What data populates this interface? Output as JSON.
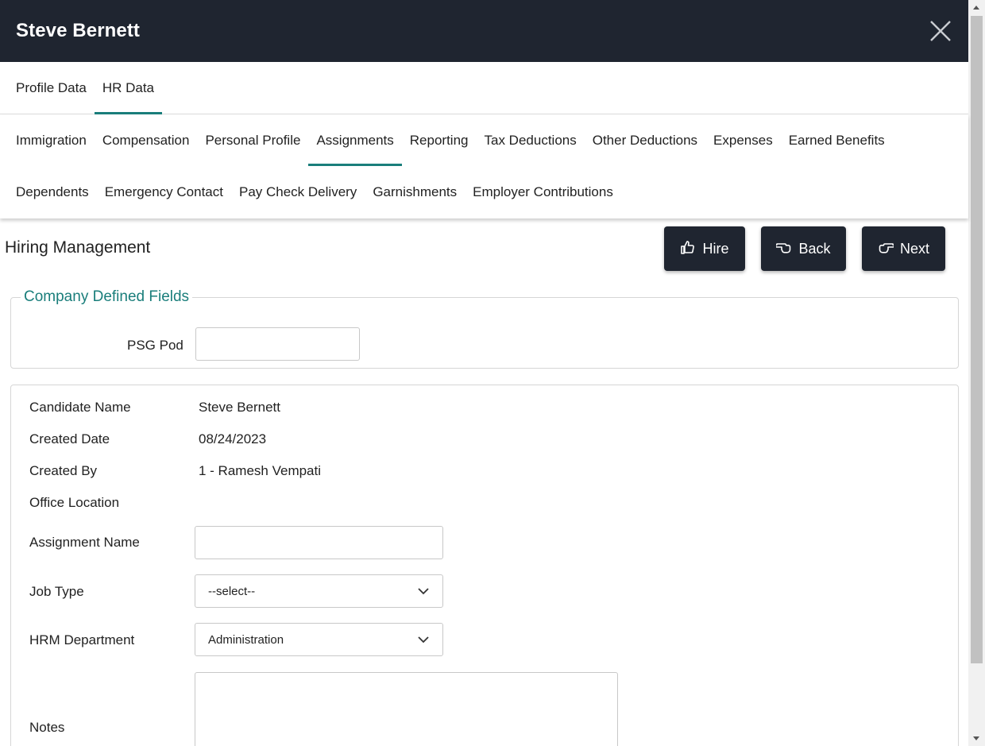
{
  "window": {
    "title": "Steve Bernett"
  },
  "primary_tabs": [
    {
      "label": "Profile Data",
      "active": false
    },
    {
      "label": "HR Data",
      "active": true
    }
  ],
  "secondary_tabs_row1": [
    {
      "label": "Immigration"
    },
    {
      "label": "Compensation"
    },
    {
      "label": "Personal Profile"
    },
    {
      "label": "Assignments",
      "active": true
    },
    {
      "label": "Reporting"
    },
    {
      "label": "Tax Deductions"
    },
    {
      "label": "Other Deductions"
    },
    {
      "label": "Expenses"
    },
    {
      "label": "Earned Benefits"
    }
  ],
  "secondary_tabs_row2": [
    {
      "label": "Dependents"
    },
    {
      "label": "Emergency Contact"
    },
    {
      "label": "Pay Check Delivery"
    },
    {
      "label": "Garnishments"
    },
    {
      "label": "Employer Contributions"
    }
  ],
  "section": {
    "title": "Hiring Management"
  },
  "actions": {
    "hire": "Hire",
    "back": "Back",
    "next": "Next"
  },
  "company_fields": {
    "legend": "Company Defined Fields",
    "psg_pod_label": "PSG Pod",
    "psg_pod_value": ""
  },
  "details": {
    "candidate_name_label": "Candidate Name",
    "candidate_name": "Steve Bernett",
    "created_date_label": "Created Date",
    "created_date": "08/24/2023",
    "created_by_label": "Created By",
    "created_by": "1 - Ramesh Vempati",
    "office_location_label": "Office Location",
    "office_location": "",
    "assignment_name_label": "Assignment Name",
    "assignment_name": "",
    "job_type_label": "Job Type",
    "job_type": "--select--",
    "hrm_department_label": "HRM Department",
    "hrm_department": "Administration",
    "notes_label": "Notes",
    "notes": ""
  },
  "colors": {
    "header_bg": "#1f2530",
    "accent": "#1a7e7b"
  },
  "icons": {
    "close": "close-icon",
    "hire": "thumbs-up-icon",
    "back": "hand-point-left-icon",
    "next": "hand-point-right-icon",
    "dropdown": "chevron-down-icon"
  }
}
